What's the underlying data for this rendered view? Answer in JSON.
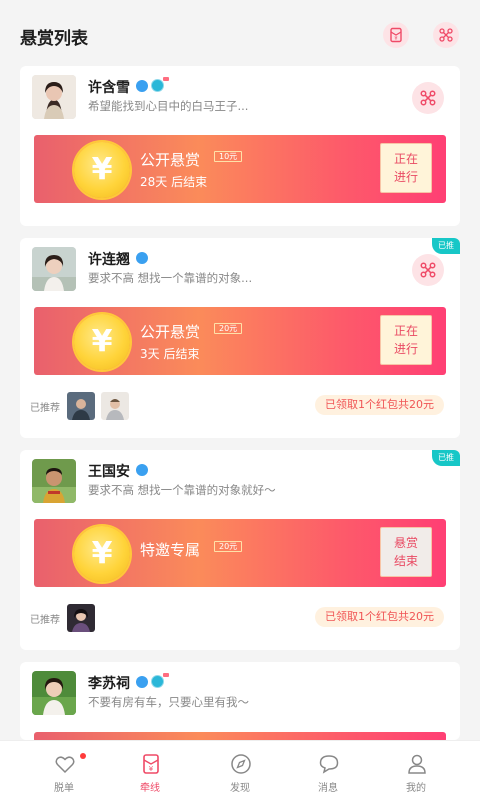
{
  "header": {
    "title": "悬赏列表"
  },
  "cards": [
    {
      "name": "许含雪",
      "desc": "希望能找到心目中的白马王子...",
      "reward_title": "公开悬赏",
      "reward_amount": "10元",
      "reward_sub": "28天 后结束",
      "status_line1": "正在",
      "status_line2": "进行"
    },
    {
      "name": "许连翘",
      "desc": "要求不高 想找一个靠谱的对象...",
      "tag": "已推",
      "reward_title": "公开悬赏",
      "reward_amount": "20元",
      "reward_sub": "3天 后结束",
      "status_line1": "正在",
      "status_line2": "进行",
      "rec_label": "已推荐",
      "packet": "已领取1个红包共20元"
    },
    {
      "name": "王国安",
      "desc": "要求不高 想找一个靠谱的对象就好～",
      "tag": "已推",
      "reward_title": "特邀专属",
      "reward_amount": "20元",
      "status_line1": "悬赏",
      "status_line2": "结束",
      "rec_label": "已推荐",
      "packet": "已领取1个红包共20元"
    },
    {
      "name": "李苏祠",
      "desc": "不要有房有车，只要心里有我～"
    }
  ],
  "tabbar": [
    {
      "label": "脱单",
      "icon": "heart-icon"
    },
    {
      "label": "牵线",
      "icon": "red-envelope-icon",
      "active": true
    },
    {
      "label": "发现",
      "icon": "compass-icon"
    },
    {
      "label": "消息",
      "icon": "chat-bubble-icon"
    },
    {
      "label": "我的",
      "icon": "person-icon"
    }
  ],
  "colors": {
    "accent": "#ef4a67",
    "reward_gradient_start": "#e9606d",
    "reward_gradient_end": "#ff3f74",
    "tag_teal": "#17c7c7"
  }
}
